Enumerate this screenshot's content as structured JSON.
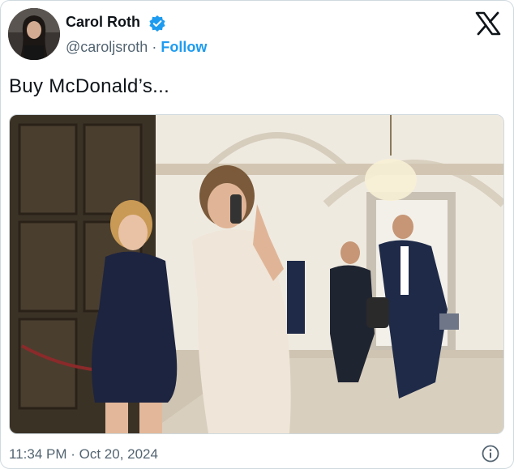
{
  "author": {
    "name": "Carol Roth",
    "handle": "@caroljsroth",
    "separator": "·",
    "follow_label": "Follow",
    "verified_color": "#1d9bf0"
  },
  "tweet": {
    "text": "Buy McDonald’s..."
  },
  "media": {
    "description_icon": "photo"
  },
  "footer": {
    "timestamp": "11:34 PM · Oct 20, 2024"
  },
  "icons": {
    "brand": "x-logo-icon",
    "info": "info-icon",
    "verified": "verified-badge-icon"
  }
}
